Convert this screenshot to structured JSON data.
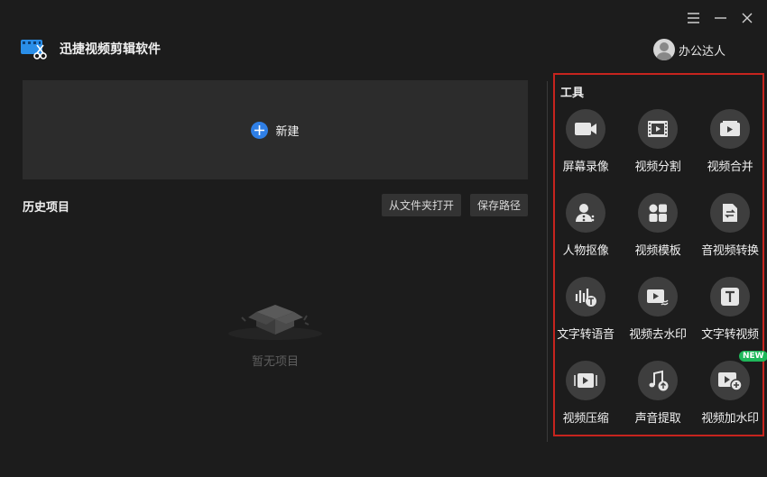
{
  "app": {
    "title": "迅捷视频剪辑软件"
  },
  "window_controls": {
    "icons": [
      "menu-icon",
      "minimize-icon",
      "close-icon"
    ]
  },
  "user": {
    "name": "办公达人"
  },
  "new_project": {
    "label": "新建"
  },
  "history": {
    "title": "历史项目",
    "open_folder_label": "从文件夹打开",
    "save_path_label": "保存路径",
    "empty_text": "暂无项目"
  },
  "tools": {
    "title": "工具",
    "items": [
      {
        "label": "屏幕录像",
        "icon": "camera-icon"
      },
      {
        "label": "视频分割",
        "icon": "film-split-icon"
      },
      {
        "label": "视频合并",
        "icon": "video-merge-icon"
      },
      {
        "label": "人物抠像",
        "icon": "person-cutout-icon"
      },
      {
        "label": "视频模板",
        "icon": "template-icon"
      },
      {
        "label": "音视频转换",
        "icon": "convert-icon"
      },
      {
        "label": "文字转语音",
        "icon": "text-to-speech-icon"
      },
      {
        "label": "视频去水印",
        "icon": "remove-watermark-icon"
      },
      {
        "label": "文字转视频",
        "icon": "text-to-video-icon"
      },
      {
        "label": "视频压缩",
        "icon": "compress-icon"
      },
      {
        "label": "声音提取",
        "icon": "audio-extract-icon"
      },
      {
        "label": "视频加水印",
        "icon": "add-watermark-icon",
        "badge": "NEW"
      }
    ]
  },
  "colors": {
    "accent": "#2f7fe6",
    "highlight_border": "#c6241e",
    "badge": "#1fb85a"
  }
}
